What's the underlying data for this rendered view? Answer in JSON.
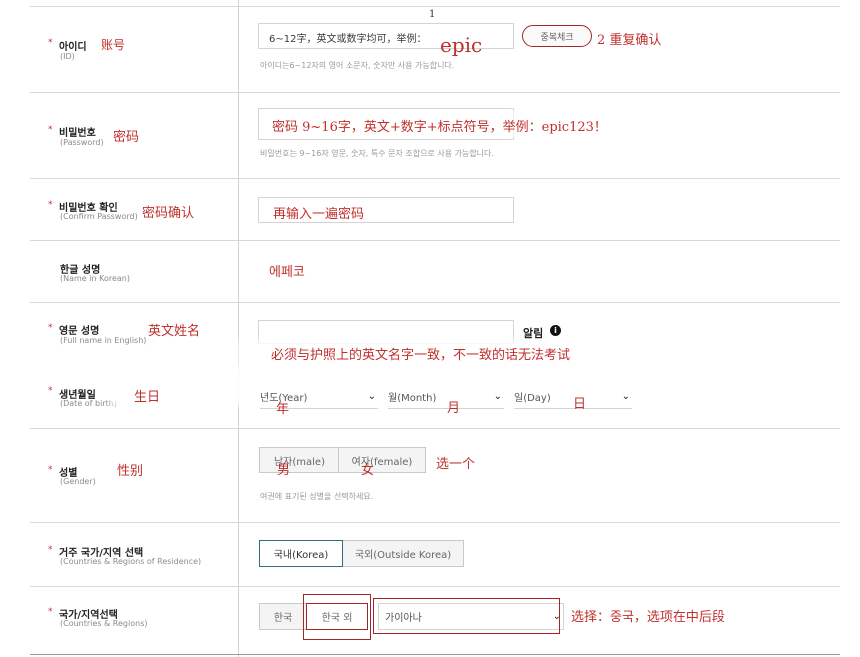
{
  "fields": {
    "id": {
      "label": "아이디",
      "sub": "(ID)",
      "ann": "账号",
      "input_text": "6~12字，英文或数字均可，举例：",
      "ann_epic": "epic",
      "top_mark": "1",
      "check_button": "중복체크",
      "ann_check": "2 重复确认",
      "hint": "아이디는6~12자의 영어 소문자, 숫자만 사용 가능합니다."
    },
    "password": {
      "label": "비밀번호",
      "sub": "(Password)",
      "ann": "密码",
      "input_text": "密码 9~16字，英文+数字+标点符号，举例：epic123！",
      "hint": "비밀번호는 9~16자 영문, 숫자, 특수 문자 조합으로 사용 가능합니다."
    },
    "confirm": {
      "label": "비밀번호 확인",
      "sub": "(Confirm Password)",
      "ann": "密码确认",
      "input_text": "再输入一遍密码"
    },
    "korean_name": {
      "label": "한글 성명",
      "sub": "(Name in Korean)",
      "ann_value": "에페코"
    },
    "english_name": {
      "label": "영문 성명",
      "sub": "(Full name in English)",
      "ann": "英文姓名",
      "alert_label": "알림",
      "ann_note": "必须与护照上的英文名字一致，不一致的话无法考试"
    },
    "birth": {
      "label": "생년월일",
      "sub": "(Date of birth)",
      "ann": "生日",
      "year": "년도(Year)",
      "month": "월(Month)",
      "day": "일(Day)",
      "ann_year": "年",
      "ann_month": "月",
      "ann_day": "日"
    },
    "gender": {
      "label": "성별",
      "sub": "(Gender)",
      "ann": "性别",
      "male": "남자(male)",
      "female": "여자(female)",
      "ann_male": "男",
      "ann_female": "女",
      "ann_pick": "选一个",
      "hint": "여권에 표기된 성별을 선택하세요."
    },
    "residence": {
      "label": "거주 국가/지역 선택",
      "sub": "(Countries & Regions of Residence)",
      "korea": "국내(Korea)",
      "outside": "국외(Outside Korea)"
    },
    "country": {
      "label": "국가/지역선택",
      "sub": "(Countries & Regions)",
      "korea": "한국",
      "outside": "한국 외",
      "select_value": "가이아나",
      "ann": "选择：중국，选项在中后段"
    }
  },
  "colors": {
    "annotation": "#c0302c",
    "selected_border": "#2f6f78",
    "circle": "#a4262c"
  }
}
